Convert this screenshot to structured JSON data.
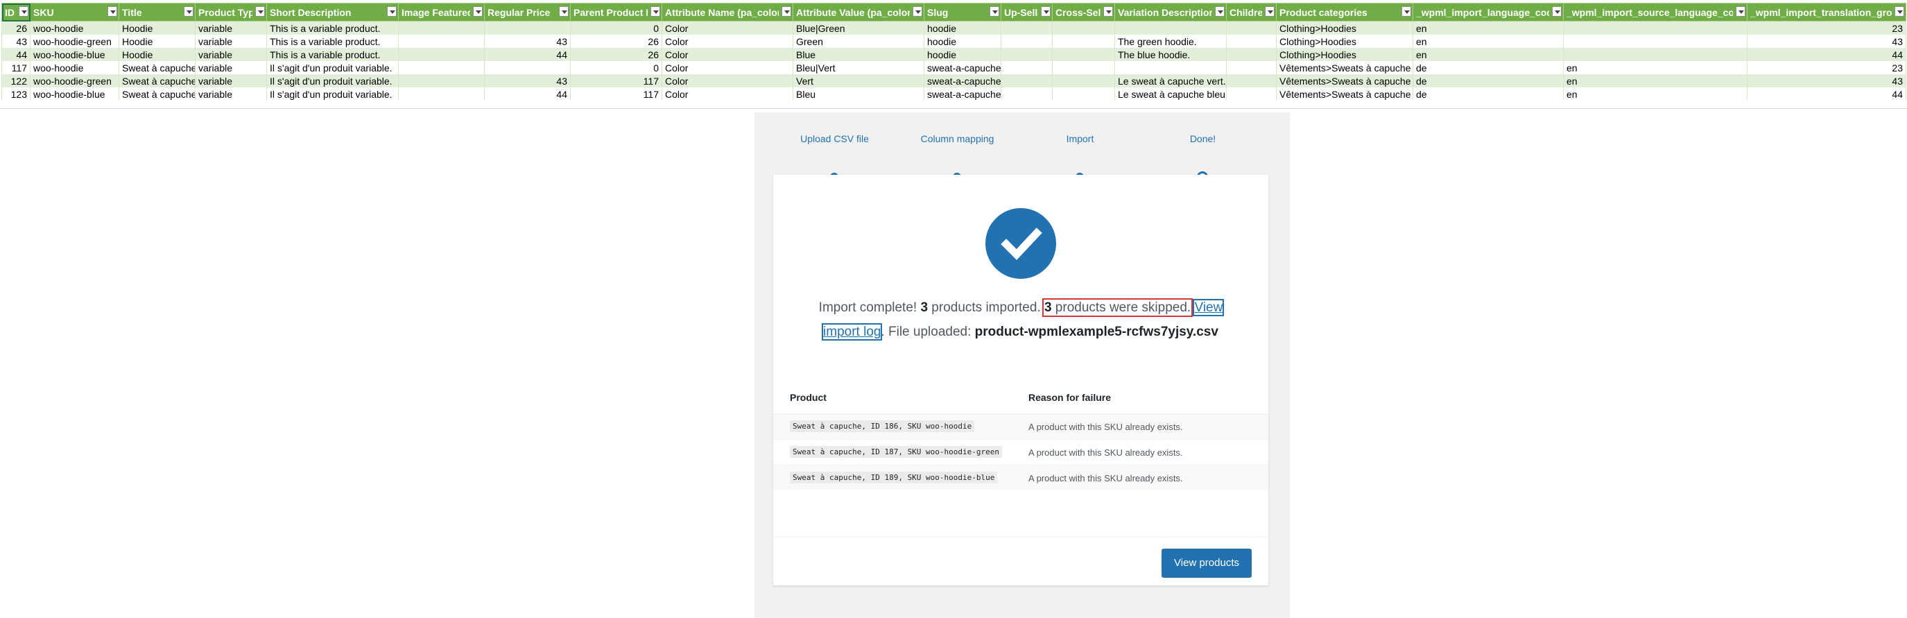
{
  "sheet": {
    "headers": [
      "ID",
      "SKU",
      "Title",
      "Product Type",
      "Short Description",
      "Image Featured",
      "Regular Price",
      "Parent Product ID",
      "Attribute Name (pa_color)",
      "Attribute Value (pa_color)",
      "Slug",
      "Up-Sells",
      "Cross-Sells",
      "Variation Description",
      "Children",
      "Product categories",
      "_wpml_import_language_code",
      "_wpml_import_source_language_code",
      "_wpml_import_translation_group"
    ],
    "rows": [
      [
        "26",
        "woo-hoodie",
        "Hoodie",
        "variable",
        "This is a variable product.",
        "",
        "",
        "0",
        "Color",
        "Blue|Green",
        "hoodie",
        "",
        "",
        "",
        "",
        "Clothing>Hoodies",
        "en",
        "",
        "23"
      ],
      [
        "43",
        "woo-hoodie-green",
        "Hoodie",
        "variable",
        "This is a variable product.",
        "",
        "43",
        "26",
        "Color",
        "Green",
        "hoodie",
        "",
        "",
        "The green hoodie.",
        "",
        "Clothing>Hoodies",
        "en",
        "",
        "43"
      ],
      [
        "44",
        "woo-hoodie-blue",
        "Hoodie",
        "variable",
        "This is a variable product.",
        "",
        "44",
        "26",
        "Color",
        "Blue",
        "hoodie",
        "",
        "",
        "The blue hoodie.",
        "",
        "Clothing>Hoodies",
        "en",
        "",
        "44"
      ],
      [
        "117",
        "woo-hoodie",
        "Sweat à capuche",
        "variable",
        "Il s'agit d'un produit variable.",
        "",
        "",
        "0",
        "Color",
        "Bleu|Vert",
        "sweat-a-capuche",
        "",
        "",
        "",
        "",
        "Vêtements>Sweats à capuche",
        "de",
        "en",
        "23"
      ],
      [
        "122",
        "woo-hoodie-green",
        "Sweat à capuche",
        "variable",
        "Il s'agit d'un produit variable.",
        "",
        "43",
        "117",
        "Color",
        "Vert",
        "sweat-a-capuche",
        "",
        "",
        "Le sweat à capuche vert.",
        "",
        "Vêtements>Sweats à capuche",
        "de",
        "en",
        "43"
      ],
      [
        "123",
        "woo-hoodie-blue",
        "Sweat à capuche",
        "variable",
        "Il s'agit d'un produit variable.",
        "",
        "44",
        "117",
        "Color",
        "Bleu",
        "sweat-a-capuche",
        "",
        "",
        "Le sweat à capuche bleu.",
        "",
        "Vêtements>Sweats à capuche",
        "de",
        "en",
        "44"
      ]
    ]
  },
  "steps": [
    "Upload CSV file",
    "Column mapping",
    "Import",
    "Done!"
  ],
  "summary": {
    "prefix": "Import complete! ",
    "imported_count": "3",
    "imported_label": " products imported.",
    "skipped_count": "3",
    "skipped_label": " products were skipped.",
    "log_link": "View import log",
    "file_label": ". File uploaded: ",
    "file_name": "product-wpmlexample5-rcfws7yjsy.csv"
  },
  "failures": {
    "col_product": "Product",
    "col_reason": "Reason for failure",
    "rows": [
      {
        "product": "Sweat à capuche, ID 186, SKU woo-hoodie",
        "reason": "A product with this SKU already exists."
      },
      {
        "product": "Sweat à capuche, ID 187, SKU woo-hoodie-green",
        "reason": "A product with this SKU already exists."
      },
      {
        "product": "Sweat à capuche, ID 189, SKU woo-hoodie-blue",
        "reason": "A product with this SKU already exists."
      }
    ]
  },
  "view_products_label": "View products",
  "colors": {
    "header_green": "#70ad47",
    "band_green": "#e2efda",
    "wp_blue": "#2271b1",
    "highlight_red": "#d63638"
  },
  "icons": [
    "filter-dropdown-icon",
    "checkmark-icon"
  ]
}
